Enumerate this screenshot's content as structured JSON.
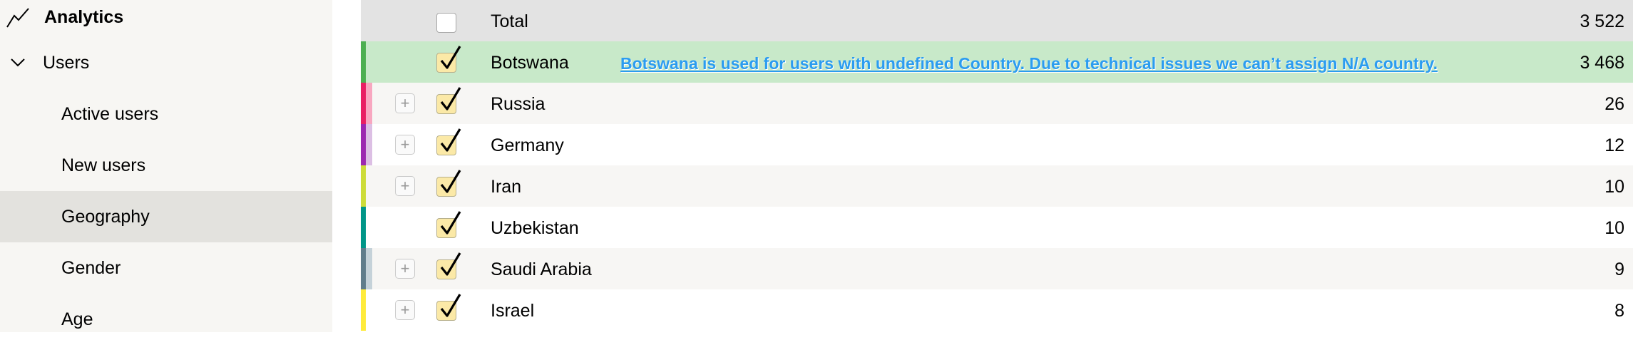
{
  "sidebar": {
    "analytics": {
      "label": "Analytics",
      "icon": "line-chart-icon"
    },
    "users": {
      "label": "Users",
      "icon": "chevron-down-icon"
    },
    "items": [
      {
        "label": "Active users"
      },
      {
        "label": "New users"
      },
      {
        "label": "Geography",
        "active": true
      },
      {
        "label": "Gender"
      },
      {
        "label": "Age"
      }
    ]
  },
  "table": {
    "total": {
      "label": "Total",
      "value": "3 522",
      "checked": false
    },
    "note": "Botswana is used for users with undefined Country. Due to technical issues we can’t assign N/A country.",
    "rows": [
      {
        "name": "Botswana",
        "value": "3 468",
        "checked": true,
        "expandable": false,
        "color": "#4caf50",
        "color2": "#c8e9c9"
      },
      {
        "name": "Russia",
        "value": "26",
        "checked": true,
        "expandable": true,
        "color": "#e91e63",
        "color2": "#f8a7c0"
      },
      {
        "name": "Germany",
        "value": "12",
        "checked": true,
        "expandable": true,
        "color": "#9c27b0",
        "color2": "#dcbfe4"
      },
      {
        "name": "Iran",
        "value": "10",
        "checked": true,
        "expandable": true,
        "color": "#cddc39",
        "color2": "#f7f6f4"
      },
      {
        "name": "Uzbekistan",
        "value": "10",
        "checked": true,
        "expandable": false,
        "color": "#009688",
        "color2": "#ffffff"
      },
      {
        "name": "Saudi Arabia",
        "value": "9",
        "checked": true,
        "expandable": true,
        "color": "#607d8b",
        "color2": "#c5d2d9"
      },
      {
        "name": "Israel",
        "value": "8",
        "checked": true,
        "expandable": true,
        "color": "#ffeb3b",
        "color2": "#ffffff"
      }
    ]
  }
}
